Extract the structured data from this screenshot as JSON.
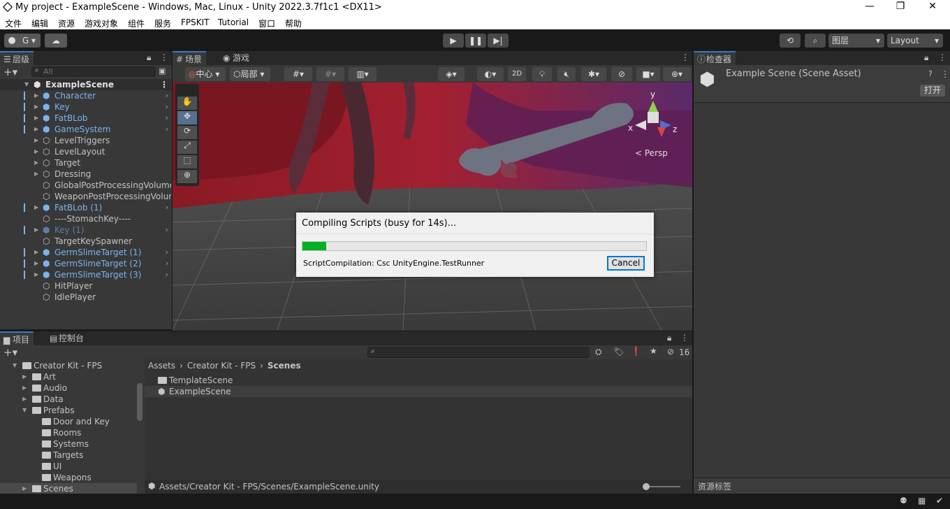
{
  "window": {
    "title": "My project - ExampleScene - Windows, Mac, Linux - Unity 2022.3.7f1c1 <DX11>"
  },
  "menu": [
    "文件",
    "编辑",
    "资源",
    "游戏对象",
    "组件",
    "服务",
    "FPSKIT",
    "Tutorial",
    "窗口",
    "帮助"
  ],
  "toolbar": {
    "account": "G",
    "layers": "图层",
    "layout": "Layout"
  },
  "hierarchy": {
    "tab": "层级",
    "search_placeholder": "All",
    "scene": "ExampleScene",
    "items": [
      {
        "label": "Character",
        "prefab": true,
        "expand": true,
        "chevron": true
      },
      {
        "label": "Key",
        "prefab": true,
        "expand": true,
        "chevron": true
      },
      {
        "label": "FatBLob",
        "prefab": true,
        "expand": true,
        "chevron": true
      },
      {
        "label": "GameSystem",
        "prefab": true,
        "expand": true,
        "chevron": true
      },
      {
        "label": "LevelTriggers",
        "prefab": false,
        "expand": true,
        "chevron": false
      },
      {
        "label": "LevelLayout",
        "prefab": false,
        "expand": true,
        "chevron": false
      },
      {
        "label": "Target",
        "prefab": false,
        "expand": true,
        "chevron": false
      },
      {
        "label": "Dressing",
        "prefab": false,
        "expand": true,
        "chevron": false
      },
      {
        "label": "GlobalPostProcessingVolume",
        "prefab": false,
        "expand": false,
        "chevron": false
      },
      {
        "label": "WeaponPostProcessingVolume",
        "prefab": false,
        "expand": false,
        "chevron": false
      },
      {
        "label": "FatBLob (1)",
        "prefab": true,
        "expand": true,
        "chevron": true
      },
      {
        "label": "----StomachKey----",
        "prefab": false,
        "expand": false,
        "chevron": false
      },
      {
        "label": "Key (1)",
        "prefab": true,
        "expand": true,
        "chevron": true,
        "dim": true
      },
      {
        "label": "TargetKeySpawner",
        "prefab": false,
        "expand": false,
        "chevron": false
      },
      {
        "label": "GermSlimeTarget (1)",
        "prefab": true,
        "expand": true,
        "chevron": true
      },
      {
        "label": "GermSlimeTarget (2)",
        "prefab": true,
        "expand": true,
        "chevron": true
      },
      {
        "label": "GermSlimeTarget (3)",
        "prefab": true,
        "expand": true,
        "chevron": true
      },
      {
        "label": "HitPlayer",
        "prefab": false,
        "expand": false,
        "chevron": false
      },
      {
        "label": "IdlePlayer",
        "prefab": false,
        "expand": false,
        "chevron": false
      }
    ]
  },
  "scene_view": {
    "tab_scene": "场景",
    "tab_game": "游戏",
    "pivot": "中心",
    "space": "局部",
    "mode_2d": "2D",
    "persp": "Persp",
    "axis_x": "x",
    "axis_y": "y",
    "axis_z": "z"
  },
  "dialog": {
    "title": "Compiling Scripts (busy for 14s)...",
    "status": "ScriptCompilation: Csc UnityEngine.TestRunner",
    "progress": 0.07,
    "cancel": "Cancel"
  },
  "inspector": {
    "tab": "检查器",
    "title": "Example Scene (Scene Asset)",
    "open": "打开",
    "footer": "资源标签"
  },
  "project": {
    "tab_project": "项目",
    "tab_console": "控制台",
    "hidden_count": "16",
    "tree": [
      {
        "label": "Creator Kit - FPS",
        "level": 0,
        "open": true,
        "arrow": true
      },
      {
        "label": "Art",
        "level": 1,
        "arrow": true
      },
      {
        "label": "Audio",
        "level": 1,
        "arrow": true
      },
      {
        "label": "Data",
        "level": 1,
        "arrow": true
      },
      {
        "label": "Prefabs",
        "level": 1,
        "open": true,
        "arrow": true
      },
      {
        "label": "Door and Key",
        "level": 2,
        "arrow": false
      },
      {
        "label": "Rooms",
        "level": 2,
        "arrow": false
      },
      {
        "label": "Systems",
        "level": 2,
        "arrow": false
      },
      {
        "label": "Targets",
        "level": 2,
        "arrow": false
      },
      {
        "label": "UI",
        "level": 2,
        "arrow": false
      },
      {
        "label": "Weapons",
        "level": 2,
        "arrow": false
      },
      {
        "label": "Scenes",
        "level": 1,
        "arrow": true,
        "selected": true
      }
    ],
    "breadcrumb": [
      "Assets",
      "Creator Kit - FPS",
      "Scenes"
    ],
    "files": [
      {
        "label": "TemplateScene",
        "kind": "folder"
      },
      {
        "label": "ExampleScene",
        "kind": "scene",
        "selected": true
      }
    ],
    "path": "Assets/Creator Kit - FPS/Scenes/ExampleScene.unity"
  },
  "colors": {
    "accent": "#3a79bb",
    "progress": "#06b025",
    "prefab": "#7bb3f0",
    "bg": "#383838"
  }
}
